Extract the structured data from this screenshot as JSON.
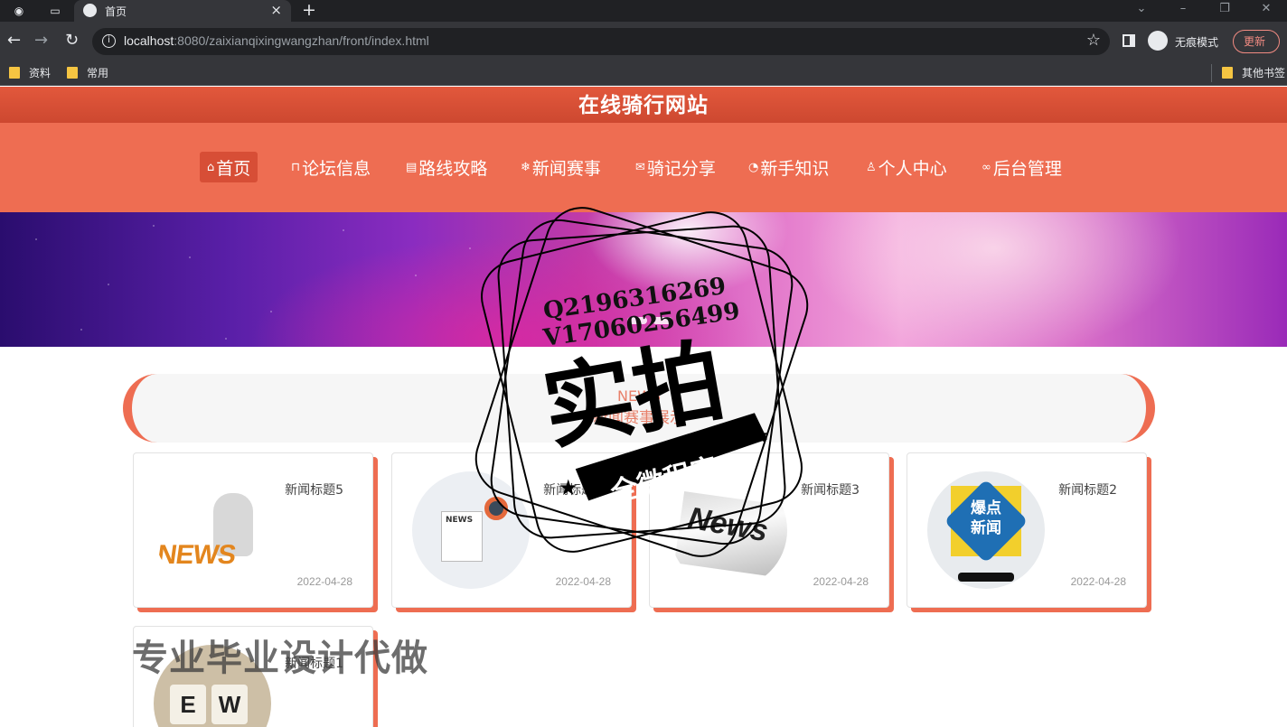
{
  "browser": {
    "tab_title": "首页",
    "url_host": "localhost",
    "url_rest": ":8080/zaixianqixingwangzhan/front/index.html",
    "incognito_label": "无痕模式",
    "update_label": "更新",
    "bookmarks": [
      "资料",
      "常用"
    ],
    "other_bookmarks": "其他书签"
  },
  "site": {
    "title": "在线骑行网站",
    "nav": [
      {
        "label": "首页",
        "icon": "home-icon",
        "active": true
      },
      {
        "label": "论坛信息",
        "icon": "book-icon"
      },
      {
        "label": "路线攻略",
        "icon": "clipboard-icon"
      },
      {
        "label": "新闻赛事",
        "icon": "snowflake-icon"
      },
      {
        "label": "骑记分享",
        "icon": "mail-icon"
      },
      {
        "label": "新手知识",
        "icon": "gauge-icon"
      },
      {
        "label": "个人中心",
        "icon": "user-icon"
      },
      {
        "label": "后台管理",
        "icon": "link-icon"
      }
    ]
  },
  "news_section": {
    "en": "NEWS",
    "cn": "新闻赛事展示"
  },
  "news": [
    {
      "title": "新闻标题5",
      "date": "2022-04-28"
    },
    {
      "title": "新闻标题4",
      "date": "2022-04-28"
    },
    {
      "title": "新闻标题3",
      "date": "2022-04-28"
    },
    {
      "title": "新闻标题2",
      "date": "2022-04-28"
    },
    {
      "title": "新闻标题1",
      "date": ""
    }
  ],
  "thumbs": {
    "t1": "NEWS",
    "t2": "NEWS",
    "t3": "News",
    "t4_line1": "爆点",
    "t4_line2": "新闻",
    "t5_a": "E",
    "t5_b": "W"
  },
  "watermark": {
    "qq": "Q2196316269",
    "v": "V17060256499",
    "big": "实拍",
    "ribbon": "全微程序",
    "bottom": "专业毕业设计代做"
  },
  "colors": {
    "header": "#cd4830",
    "nav": "#ee6d52",
    "accent": "#ee6d52"
  }
}
